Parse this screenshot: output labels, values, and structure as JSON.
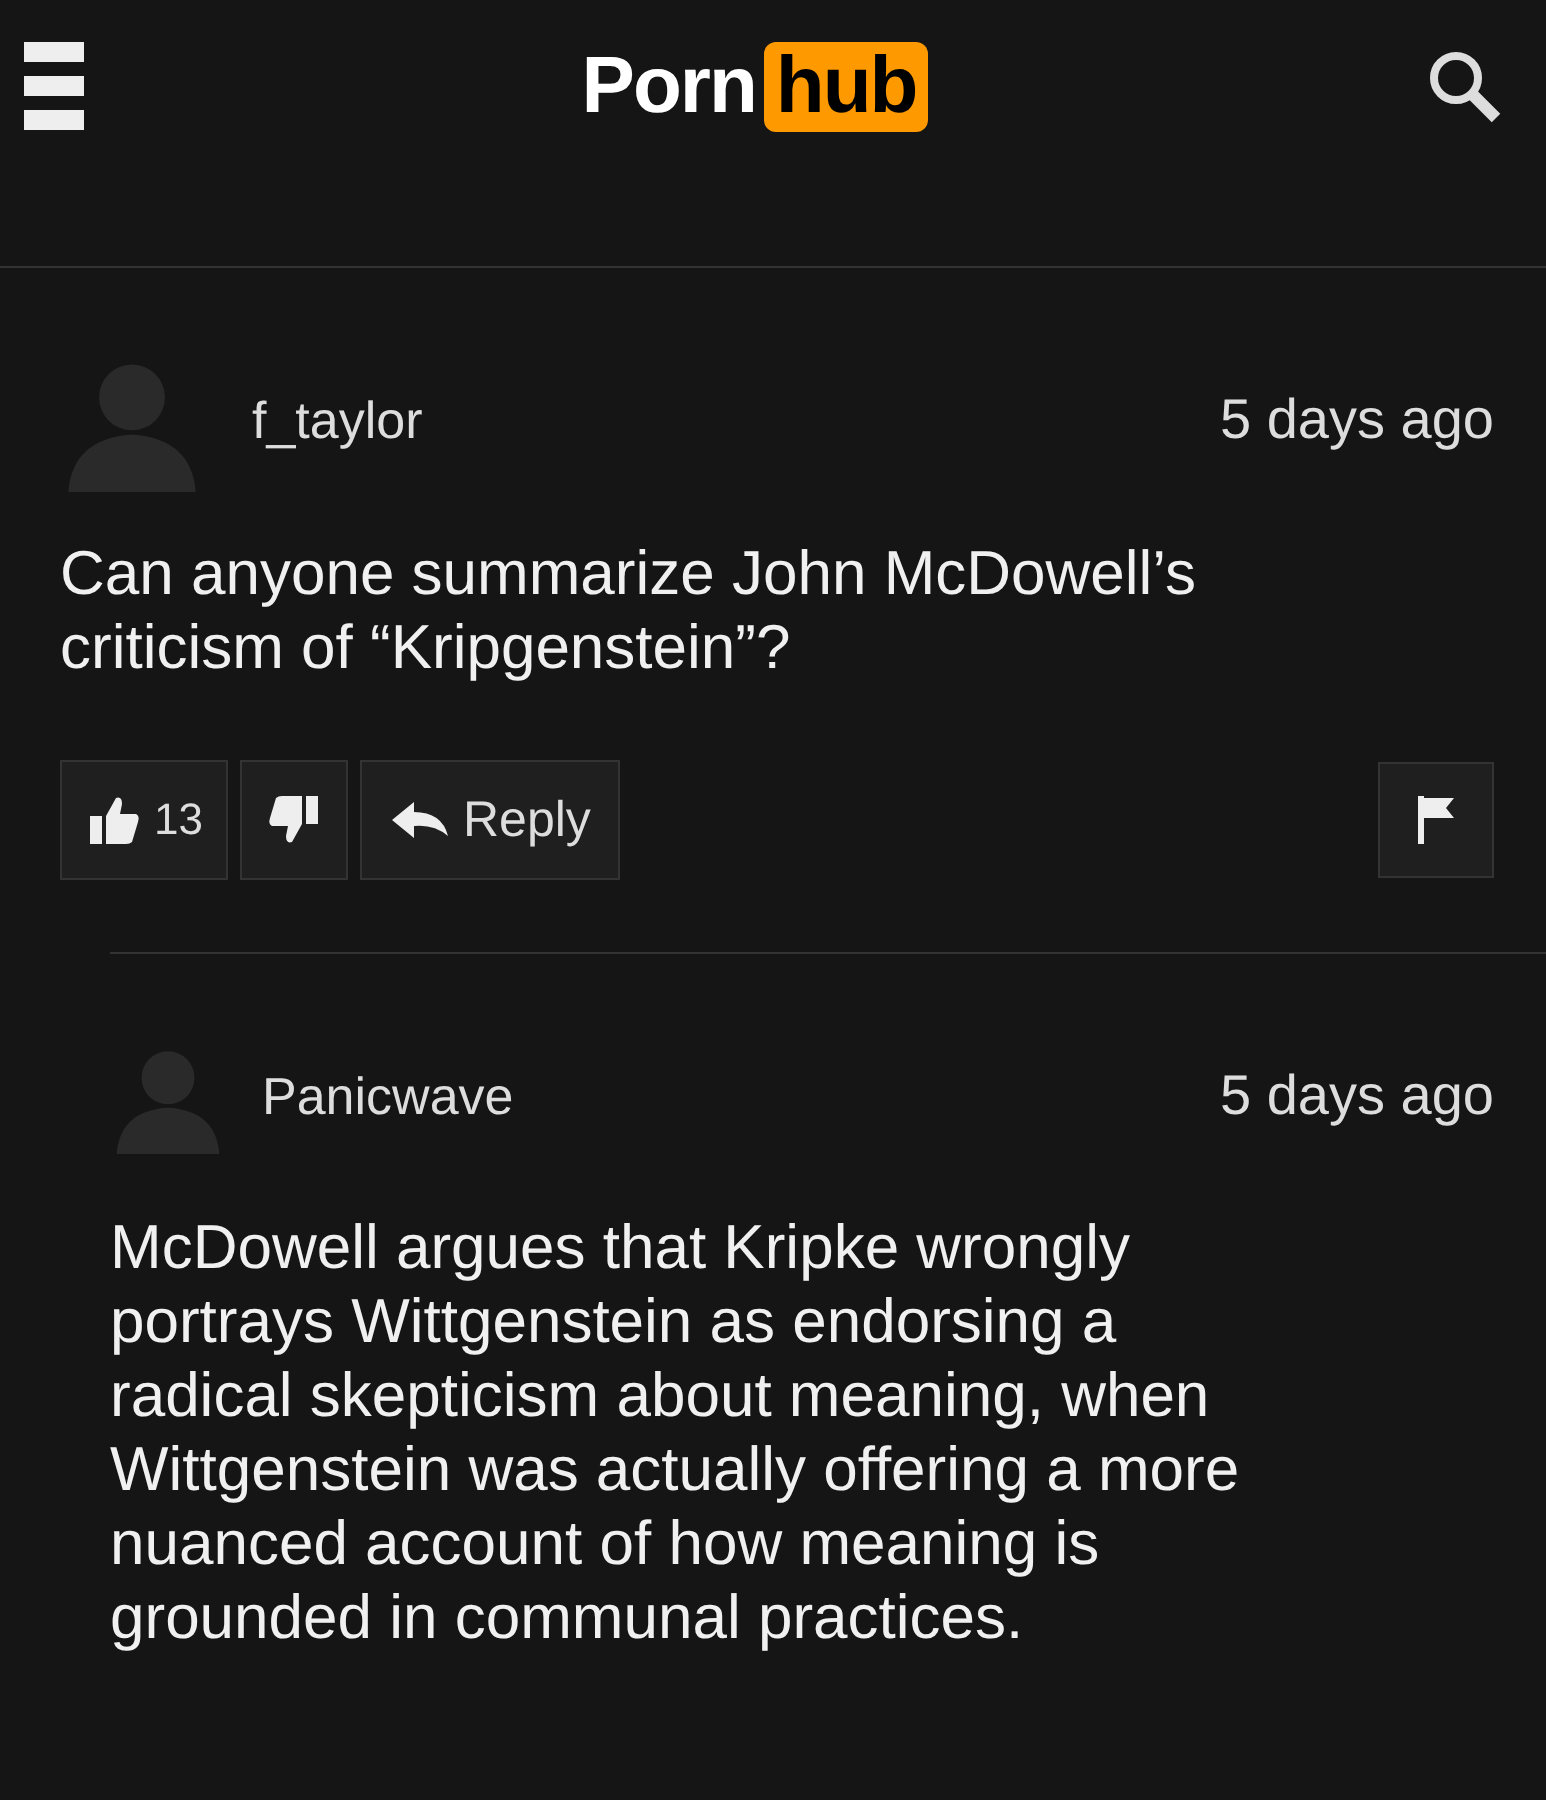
{
  "header": {
    "logo_left": "Porn",
    "logo_right": "hub"
  },
  "comments": [
    {
      "username": "f_taylor",
      "time": "5 days ago",
      "text": "Can anyone summarize John McDowell’s criticism of “Kripgenstein”?",
      "likes": "13",
      "reply_label": "Reply"
    },
    {
      "username": "Panicwave",
      "time": "5 days ago",
      "text": "McDowell argues that Kripke wrongly portrays Wittgenstein as endorsing a radical skepticism about meaning, when Wittgenstein was actually offering a more nuanced account of how meaning is grounded in communal practices."
    }
  ]
}
